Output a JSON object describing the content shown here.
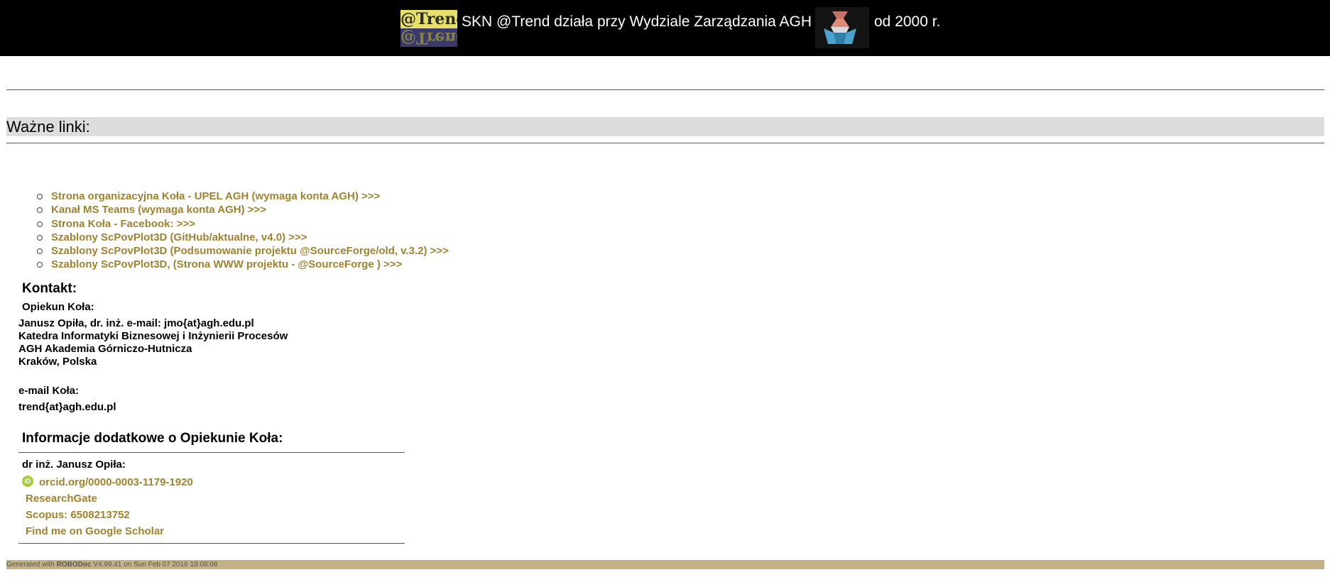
{
  "header": {
    "logo_text": "@Trend",
    "text": "SKN @Trend działa przy Wydziale Zarządzania AGH",
    "text_after": "od 2000 r."
  },
  "section": {
    "title": "Ważne linki:"
  },
  "links": [
    {
      "label": "Strona organizacyjna Koła - UPEL AGH (wymaga konta AGH)   >>>"
    },
    {
      "label": "Kanał MS Teams (wymaga konta AGH)   >>>"
    },
    {
      "label": "Strona Koła - Facebook:   >>>"
    },
    {
      "label": "Szablony ScPovPlot3D (GitHub/aktualne, v4.0)   >>>"
    },
    {
      "label": "Szablony ScPovPlot3D (Podsumowanie projektu @SourceForge/old, v.3.2)   >>>"
    },
    {
      "label": "Szablony ScPovPlot3D, (Strona WWW projektu - @SourceForge )   >>>"
    }
  ],
  "contact": {
    "title": "Kontakt:",
    "supervisor_label": "Opiekun Koła:",
    "address_lines": [
      "Janusz Opiła, dr. inż. e-mail:  jmo{at}agh.edu.pl",
      "Katedra Informatyki Biznesowej i Inżynierii Procesów",
      "AGH Akademia Górniczo-Hutnicza",
      "Kraków, Polska"
    ],
    "email_label": "e-mail Koła:",
    "email_value": "trend{at}agh.edu.pl"
  },
  "info": {
    "title": "Informacje dodatkowe o Opiekunie Koła:",
    "name": "dr inż. Janusz Opiła:",
    "orcid_icon_text": "iD",
    "orcid": "orcid.org/0000-0003-1179-1920",
    "researchgate": "ResearchGate",
    "scopus": "Scopus: 6508213752",
    "scholar": "Find me on Google Scholar"
  },
  "footer": {
    "prefix": "Generated with ",
    "tool": "ROBODoc",
    "suffix": " V4.99.41 on Sun Feb 07 2016 18:08:08"
  },
  "colors": {
    "link": "#a0822e",
    "footer_bg": "#c4b185",
    "header_bg": "#000000",
    "section_bg": "#dddddd"
  }
}
